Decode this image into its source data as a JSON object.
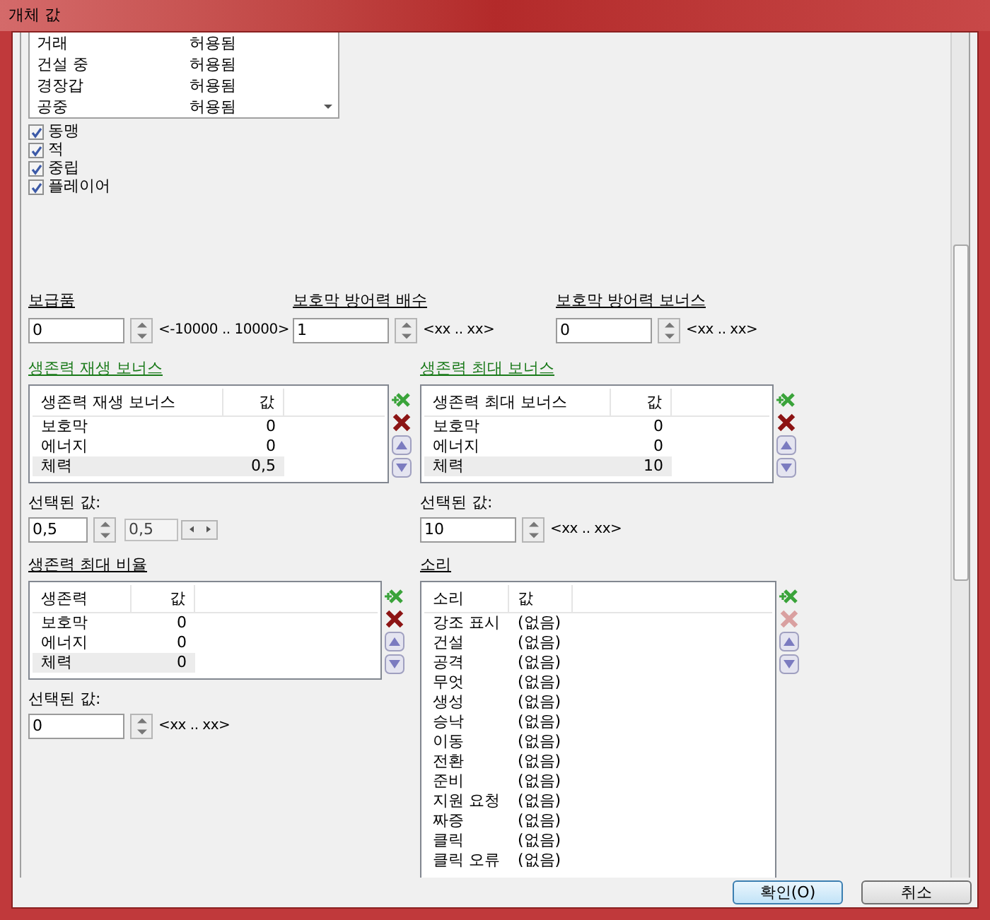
{
  "window": {
    "title": "개체 값"
  },
  "filter_list": {
    "rows": [
      {
        "name": "거래",
        "value": "허용됨"
      },
      {
        "name": "건설 중",
        "value": "허용됨"
      },
      {
        "name": "경장갑",
        "value": "허용됨"
      },
      {
        "name": "공중",
        "value": "허용됨"
      }
    ]
  },
  "checkboxes": [
    {
      "label": "동맹",
      "checked": true
    },
    {
      "label": "적",
      "checked": true
    },
    {
      "label": "중립",
      "checked": true
    },
    {
      "label": "플레이어",
      "checked": true
    }
  ],
  "fields": [
    {
      "label": "보급품",
      "value": "0",
      "range": "<-10000 .. 10000>"
    },
    {
      "label": "보호막 방어력 배수",
      "value": "1",
      "range": "<xx .. xx>"
    },
    {
      "label": "보호막 방어력 보너스",
      "value": "0",
      "range": "<xx .. xx>"
    }
  ],
  "tables": [
    {
      "title": "생존력 재생 보너스",
      "highlighted": true,
      "columns": [
        "생존력 재생 보너스",
        "값"
      ],
      "delete_disabled": false,
      "rows": [
        {
          "name": "보호막",
          "value": "0",
          "selected": false
        },
        {
          "name": "에너지",
          "value": "0",
          "selected": false
        },
        {
          "name": "체력",
          "value": "0,5",
          "selected": true
        }
      ],
      "selected_label": "선택된 값:",
      "selected_value": "0,5",
      "range_value": "0,5"
    },
    {
      "title": "생존력 최대 보너스",
      "highlighted": true,
      "columns": [
        "생존력 최대 보너스",
        "값"
      ],
      "delete_disabled": false,
      "rows": [
        {
          "name": "보호막",
          "value": "0",
          "selected": false
        },
        {
          "name": "에너지",
          "value": "0",
          "selected": false
        },
        {
          "name": "체력",
          "value": "10",
          "selected": true
        }
      ],
      "selected_label": "선택된 값:",
      "selected_value": "10",
      "range": "<xx .. xx>"
    },
    {
      "title": "생존력 최대 비율",
      "highlighted": false,
      "columns": [
        "생존력",
        "값"
      ],
      "delete_disabled": false,
      "rows": [
        {
          "name": "보호막",
          "value": "0",
          "selected": false
        },
        {
          "name": "에너지",
          "value": "0",
          "selected": false
        },
        {
          "name": "체력",
          "value": "0",
          "selected": true
        }
      ],
      "selected_label": "선택된 값:",
      "selected_value": "0",
      "range": "<xx .. xx>"
    },
    {
      "title": "소리",
      "highlighted": false,
      "columns": [
        "소리",
        "값"
      ],
      "delete_disabled": true,
      "rows": [
        {
          "name": "강조 표시",
          "value": "(없음)",
          "selected": false
        },
        {
          "name": "건설",
          "value": "(없음)",
          "selected": false
        },
        {
          "name": "공격",
          "value": "(없음)",
          "selected": false
        },
        {
          "name": "무엇",
          "value": "(없음)",
          "selected": false
        },
        {
          "name": "생성",
          "value": "(없음)",
          "selected": false
        },
        {
          "name": "승낙",
          "value": "(없음)",
          "selected": false
        },
        {
          "name": "이동",
          "value": "(없음)",
          "selected": false
        },
        {
          "name": "전환",
          "value": "(없음)",
          "selected": false
        },
        {
          "name": "준비",
          "value": "(없음)",
          "selected": false
        },
        {
          "name": "지원 요청",
          "value": "(없음)",
          "selected": false
        },
        {
          "name": "짜증",
          "value": "(없음)",
          "selected": false
        },
        {
          "name": "클릭",
          "value": "(없음)",
          "selected": false
        },
        {
          "name": "클릭 오류",
          "value": "(없음)",
          "selected": false
        }
      ]
    }
  ],
  "buttons": [
    {
      "label": "확인(O)",
      "default": true
    },
    {
      "label": "취소",
      "default": false
    }
  ]
}
